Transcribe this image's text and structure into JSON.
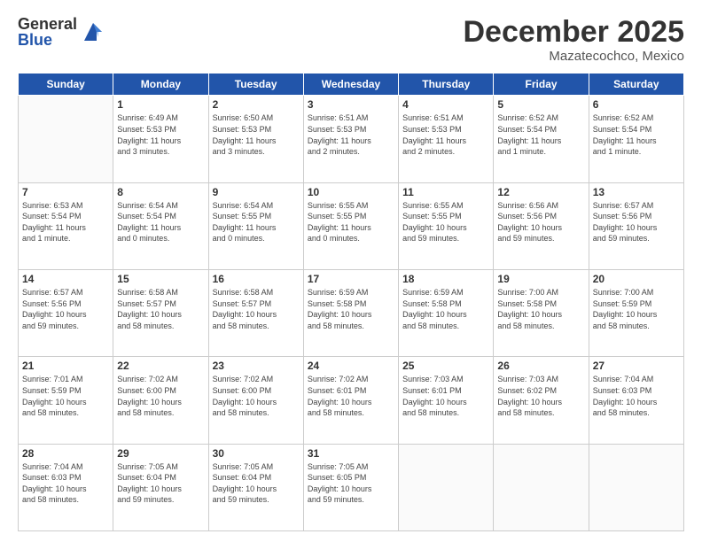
{
  "header": {
    "logo_general": "General",
    "logo_blue": "Blue",
    "month": "December 2025",
    "location": "Mazatecochco, Mexico"
  },
  "weekdays": [
    "Sunday",
    "Monday",
    "Tuesday",
    "Wednesday",
    "Thursday",
    "Friday",
    "Saturday"
  ],
  "weeks": [
    [
      {
        "day": "",
        "info": ""
      },
      {
        "day": "1",
        "info": "Sunrise: 6:49 AM\nSunset: 5:53 PM\nDaylight: 11 hours\nand 3 minutes."
      },
      {
        "day": "2",
        "info": "Sunrise: 6:50 AM\nSunset: 5:53 PM\nDaylight: 11 hours\nand 3 minutes."
      },
      {
        "day": "3",
        "info": "Sunrise: 6:51 AM\nSunset: 5:53 PM\nDaylight: 11 hours\nand 2 minutes."
      },
      {
        "day": "4",
        "info": "Sunrise: 6:51 AM\nSunset: 5:53 PM\nDaylight: 11 hours\nand 2 minutes."
      },
      {
        "day": "5",
        "info": "Sunrise: 6:52 AM\nSunset: 5:54 PM\nDaylight: 11 hours\nand 1 minute."
      },
      {
        "day": "6",
        "info": "Sunrise: 6:52 AM\nSunset: 5:54 PM\nDaylight: 11 hours\nand 1 minute."
      }
    ],
    [
      {
        "day": "7",
        "info": "Sunrise: 6:53 AM\nSunset: 5:54 PM\nDaylight: 11 hours\nand 1 minute."
      },
      {
        "day": "8",
        "info": "Sunrise: 6:54 AM\nSunset: 5:54 PM\nDaylight: 11 hours\nand 0 minutes."
      },
      {
        "day": "9",
        "info": "Sunrise: 6:54 AM\nSunset: 5:55 PM\nDaylight: 11 hours\nand 0 minutes."
      },
      {
        "day": "10",
        "info": "Sunrise: 6:55 AM\nSunset: 5:55 PM\nDaylight: 11 hours\nand 0 minutes."
      },
      {
        "day": "11",
        "info": "Sunrise: 6:55 AM\nSunset: 5:55 PM\nDaylight: 10 hours\nand 59 minutes."
      },
      {
        "day": "12",
        "info": "Sunrise: 6:56 AM\nSunset: 5:56 PM\nDaylight: 10 hours\nand 59 minutes."
      },
      {
        "day": "13",
        "info": "Sunrise: 6:57 AM\nSunset: 5:56 PM\nDaylight: 10 hours\nand 59 minutes."
      }
    ],
    [
      {
        "day": "14",
        "info": "Sunrise: 6:57 AM\nSunset: 5:56 PM\nDaylight: 10 hours\nand 59 minutes."
      },
      {
        "day": "15",
        "info": "Sunrise: 6:58 AM\nSunset: 5:57 PM\nDaylight: 10 hours\nand 58 minutes."
      },
      {
        "day": "16",
        "info": "Sunrise: 6:58 AM\nSunset: 5:57 PM\nDaylight: 10 hours\nand 58 minutes."
      },
      {
        "day": "17",
        "info": "Sunrise: 6:59 AM\nSunset: 5:58 PM\nDaylight: 10 hours\nand 58 minutes."
      },
      {
        "day": "18",
        "info": "Sunrise: 6:59 AM\nSunset: 5:58 PM\nDaylight: 10 hours\nand 58 minutes."
      },
      {
        "day": "19",
        "info": "Sunrise: 7:00 AM\nSunset: 5:58 PM\nDaylight: 10 hours\nand 58 minutes."
      },
      {
        "day": "20",
        "info": "Sunrise: 7:00 AM\nSunset: 5:59 PM\nDaylight: 10 hours\nand 58 minutes."
      }
    ],
    [
      {
        "day": "21",
        "info": "Sunrise: 7:01 AM\nSunset: 5:59 PM\nDaylight: 10 hours\nand 58 minutes."
      },
      {
        "day": "22",
        "info": "Sunrise: 7:02 AM\nSunset: 6:00 PM\nDaylight: 10 hours\nand 58 minutes."
      },
      {
        "day": "23",
        "info": "Sunrise: 7:02 AM\nSunset: 6:00 PM\nDaylight: 10 hours\nand 58 minutes."
      },
      {
        "day": "24",
        "info": "Sunrise: 7:02 AM\nSunset: 6:01 PM\nDaylight: 10 hours\nand 58 minutes."
      },
      {
        "day": "25",
        "info": "Sunrise: 7:03 AM\nSunset: 6:01 PM\nDaylight: 10 hours\nand 58 minutes."
      },
      {
        "day": "26",
        "info": "Sunrise: 7:03 AM\nSunset: 6:02 PM\nDaylight: 10 hours\nand 58 minutes."
      },
      {
        "day": "27",
        "info": "Sunrise: 7:04 AM\nSunset: 6:03 PM\nDaylight: 10 hours\nand 58 minutes."
      }
    ],
    [
      {
        "day": "28",
        "info": "Sunrise: 7:04 AM\nSunset: 6:03 PM\nDaylight: 10 hours\nand 58 minutes."
      },
      {
        "day": "29",
        "info": "Sunrise: 7:05 AM\nSunset: 6:04 PM\nDaylight: 10 hours\nand 59 minutes."
      },
      {
        "day": "30",
        "info": "Sunrise: 7:05 AM\nSunset: 6:04 PM\nDaylight: 10 hours\nand 59 minutes."
      },
      {
        "day": "31",
        "info": "Sunrise: 7:05 AM\nSunset: 6:05 PM\nDaylight: 10 hours\nand 59 minutes."
      },
      {
        "day": "",
        "info": ""
      },
      {
        "day": "",
        "info": ""
      },
      {
        "day": "",
        "info": ""
      }
    ]
  ]
}
